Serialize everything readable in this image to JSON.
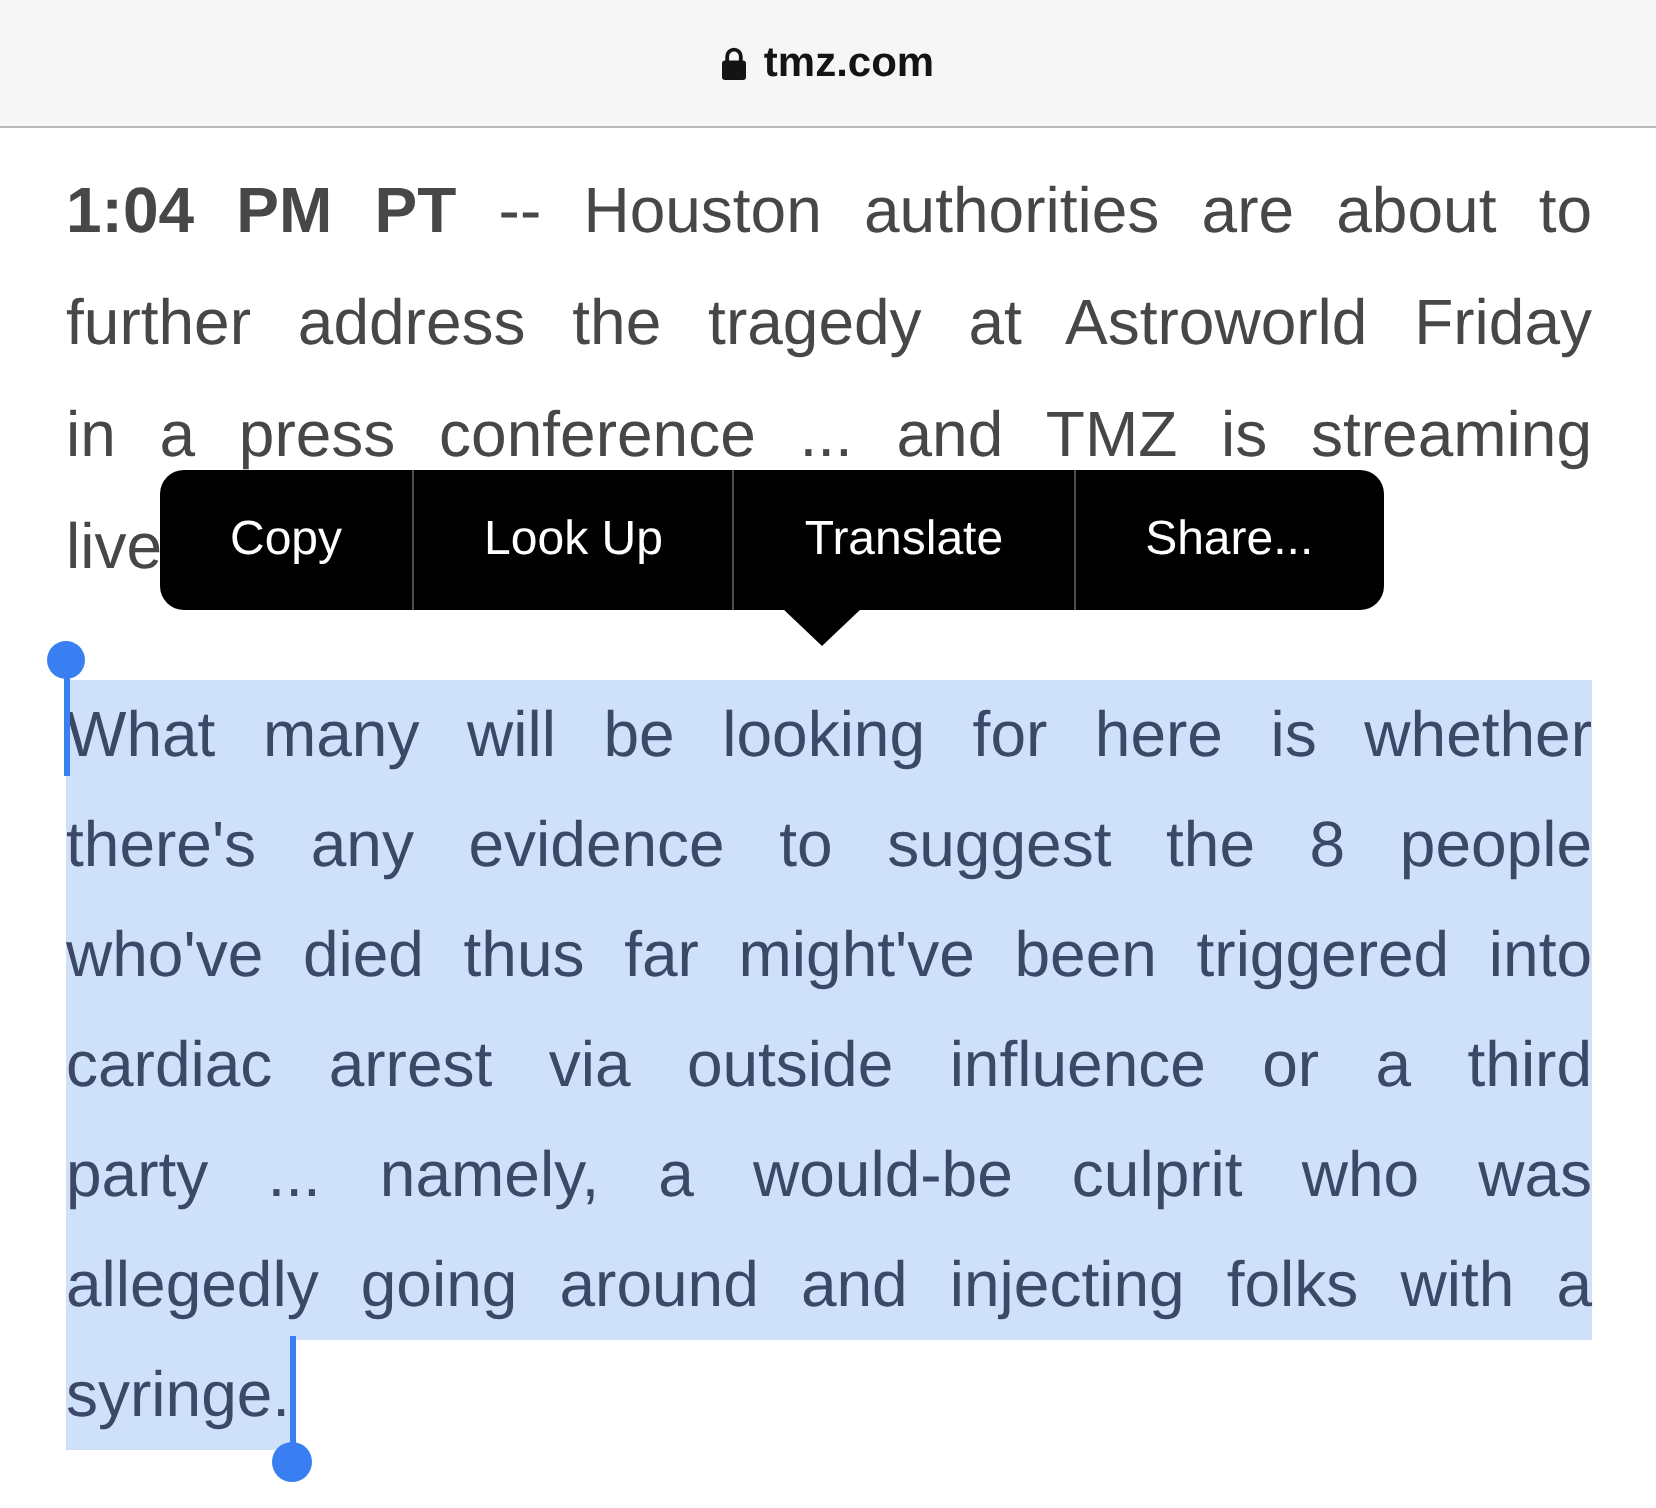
{
  "address_bar": {
    "url": "tmz.com",
    "secure": true
  },
  "paragraphs": [
    {
      "kind": "covered",
      "selected": false,
      "lines": [
        "**1:04 PM PT** -- Houston authorities are about to",
        "further address the tragedy at Astroworld Friday",
        "in a press conference ... and TMZ is streaming",
        "live"
      ]
    },
    {
      "kind": "full",
      "selected": true,
      "lines": [
        "What many will be looking for here is whether",
        "there's any evidence to suggest the 8 people",
        "who've died thus far might've been triggered into",
        "cardiac arrest via outside influence or a third",
        "party ... namely, a would-be culprit who was",
        "allegedly going around and injecting folks with a",
        "syringe."
      ]
    }
  ],
  "context_menu": {
    "items": [
      {
        "label": "Copy"
      },
      {
        "label": "Look Up"
      },
      {
        "label": "Translate"
      },
      {
        "label": "Share..."
      }
    ]
  }
}
